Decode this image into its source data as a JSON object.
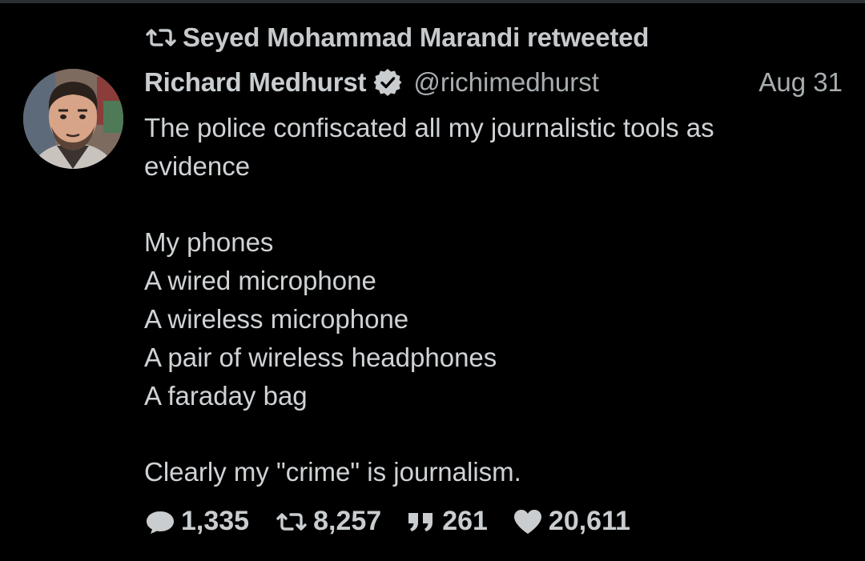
{
  "retweet_banner": {
    "icon": "retweet-icon",
    "text": "Seyed Mohammad Marandi retweeted"
  },
  "author": {
    "display_name": "Richard Medhurst",
    "verified_icon": "verified-badge-icon",
    "handle": "@richimedhurst",
    "avatar": "avatar"
  },
  "timestamp": "Aug 31",
  "tweet": {
    "lines": [
      "The police confiscated all my journalistic tools as",
      "evidence",
      "",
      "My phones",
      "A wired microphone",
      "A wireless microphone",
      "A pair of wireless headphones",
      "A faraday bag",
      "",
      "Clearly my \"crime\" is journalism."
    ]
  },
  "stats": {
    "replies": "1,335",
    "retweets": "8,257",
    "quotes": "261",
    "likes": "20,611"
  },
  "colors": {
    "background": "#000000",
    "text": "#cfd3d6",
    "muted": "#a8adb0"
  }
}
